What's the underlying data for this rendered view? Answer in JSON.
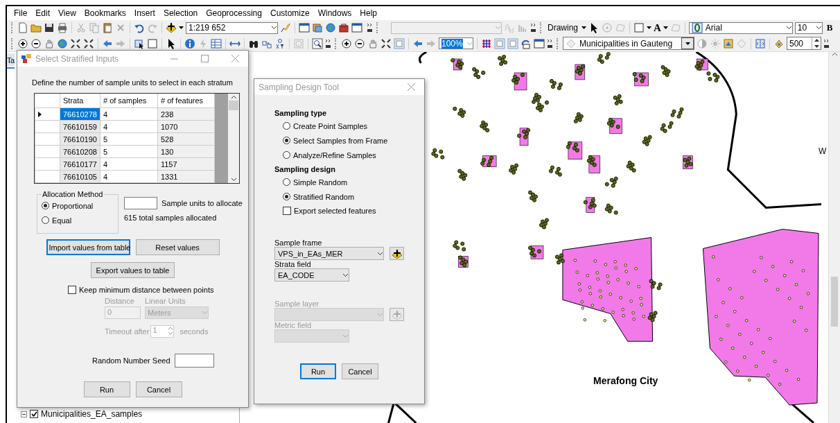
{
  "menu_bar": {
    "items": [
      "File",
      "Edit",
      "View",
      "Bookmarks",
      "Insert",
      "Selection",
      "Geoprocessing",
      "Customize",
      "Windows",
      "Help"
    ]
  },
  "toolbar_1": {
    "scale": "1:219 652",
    "drawing_menu": "Drawing",
    "text_tool": "A",
    "font": "Arial",
    "font_size": "10",
    "bold_button": "B"
  },
  "toolbar_2": {
    "zoom": {
      "value": "100%",
      "selected": true
    },
    "layer": "Municipalities in Gauteng",
    "value": "500"
  },
  "toc": {
    "tab": "Ta",
    "layers": [
      {
        "name": "Municipalities_EA_samples",
        "checked": true,
        "expanded": true
      }
    ]
  },
  "map": {
    "labels": [
      "Merafong City",
      "W"
    ]
  },
  "stratified_dialog": {
    "title": "Select Stratified Inputs",
    "instruction": "Define the number of sample units to select in each stratum",
    "columns": [
      "Strata",
      "# of samples",
      "# of features"
    ],
    "rows": [
      {
        "strata": "76610278",
        "samples": "4",
        "features": "238",
        "current": true,
        "selected": true
      },
      {
        "strata": "76610159",
        "samples": "4",
        "features": "1070",
        "current": false,
        "selected": false
      },
      {
        "strata": "76610190",
        "samples": "5",
        "features": "528",
        "current": false,
        "selected": false
      },
      {
        "strata": "76610208",
        "samples": "5",
        "features": "130",
        "current": false,
        "selected": false
      },
      {
        "strata": "76610177",
        "samples": "4",
        "features": "1157",
        "current": false,
        "selected": false
      },
      {
        "strata": "76610105",
        "samples": "4",
        "features": "1331",
        "current": false,
        "selected": false
      }
    ],
    "allocation": {
      "title": "Allocation Method",
      "options": [
        {
          "label": "Proportional",
          "selected": true
        },
        {
          "label": "Equal",
          "selected": false
        }
      ]
    },
    "units_label": "Sample units to allocate",
    "total": "615 total samples allocated",
    "import_button": {
      "label": "Import values from table",
      "focused": true
    },
    "reset_button": {
      "label": "Reset values",
      "focused": false
    },
    "export_button": {
      "label": "Export values to table",
      "focused": false
    },
    "keep_distance": {
      "label": "Keep minimum distance between points",
      "checked": false
    },
    "distance": {
      "disabled": true,
      "distance_label": "Distance",
      "distance_value": "0",
      "units_label": "Linear Units",
      "units_value": "Meters",
      "timeout_label": "Timeout after",
      "timeout_value": "1",
      "seconds_label": "seconds"
    },
    "seed_label": "Random Number Seed",
    "run_button": {
      "label": "Run",
      "focused": false
    },
    "cancel_button": {
      "label": "Cancel",
      "focused": false
    }
  },
  "sampling_dialog": {
    "title": "Sampling Design Tool",
    "sampling_type": {
      "heading": "Sampling type",
      "options": [
        {
          "label": "Create Point Samples",
          "selected": false
        },
        {
          "label": "Select Samples from Frame",
          "selected": true
        },
        {
          "label": "Analyze/Refine Samples",
          "selected": false
        }
      ]
    },
    "sampling_design": {
      "heading": "Sampling design",
      "options": [
        {
          "label": "Simple Random",
          "selected": false
        },
        {
          "label": "Stratified Random",
          "selected": true
        }
      ],
      "export": {
        "label": "Export selected features",
        "checked": false
      }
    },
    "sample_frame": {
      "label": "Sample frame",
      "value": "VPS_in_EAs_MER",
      "disabled": false
    },
    "strata_field": {
      "label": "Strata field",
      "value": "EA_CODE",
      "disabled": false
    },
    "sample_layer": {
      "label": "Sample layer",
      "disabled": true
    },
    "metric_field": {
      "label": "Metric field",
      "disabled": true
    },
    "run_button": {
      "label": "Run",
      "focused": true
    },
    "cancel_button": {
      "label": "Cancel",
      "focused": false
    }
  }
}
